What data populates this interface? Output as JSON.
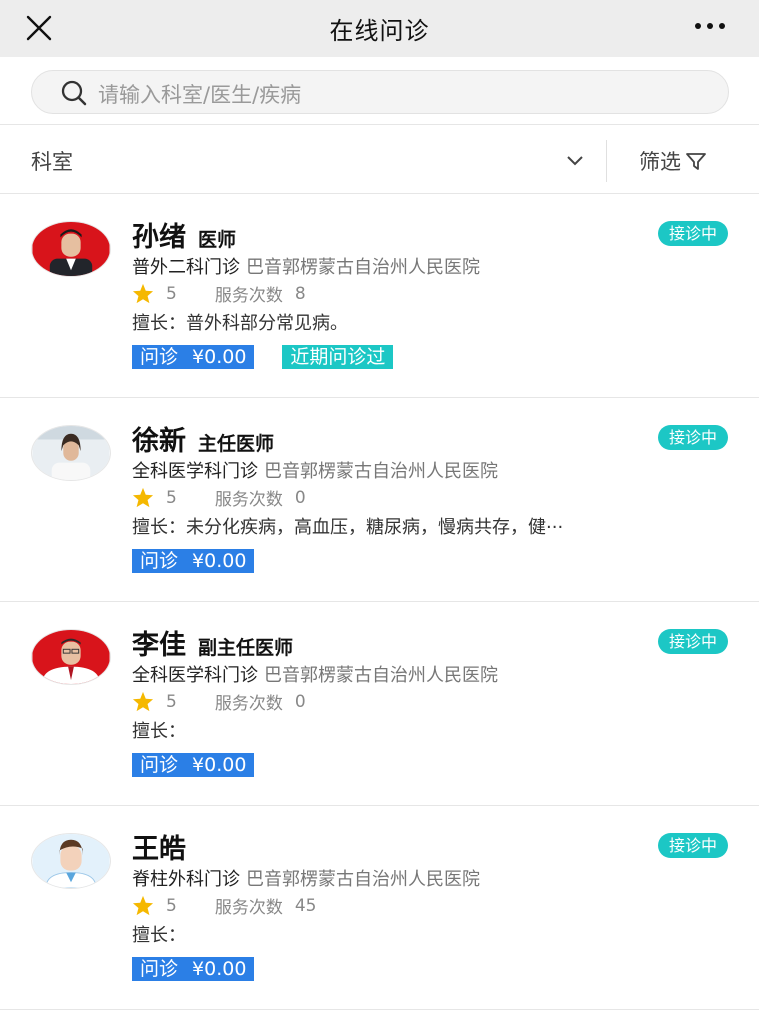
{
  "header": {
    "title": "在线问诊"
  },
  "search": {
    "placeholder": "请输入科室/医生/疾病"
  },
  "filter_bar": {
    "department_label": "科室",
    "filter_label": "筛选"
  },
  "doctors": [
    {
      "name": "孙绪",
      "title": "医师",
      "status": "接诊中",
      "department": "普外二科门诊",
      "hospital": "巴音郭楞蒙古自治州人民医院",
      "rating": "5",
      "service_label": "服务次数",
      "service_count": "8",
      "expertise": "擅长：普外科部分常见病。",
      "consult_label": "问诊",
      "price": "¥0.00",
      "recent_tag": "近期问诊过"
    },
    {
      "name": "徐新",
      "title": "主任医师",
      "status": "接诊中",
      "department": "全科医学科门诊",
      "hospital": "巴音郭楞蒙古自治州人民医院",
      "rating": "5",
      "service_label": "服务次数",
      "service_count": "0",
      "expertise": "擅长：未分化疾病，高血压，糖尿病，慢病共存，健···",
      "consult_label": "问诊",
      "price": "¥0.00"
    },
    {
      "name": "李佳",
      "title": "副主任医师",
      "status": "接诊中",
      "department": "全科医学科门诊",
      "hospital": "巴音郭楞蒙古自治州人民医院",
      "rating": "5",
      "service_label": "服务次数",
      "service_count": "0",
      "expertise": "擅长：",
      "consult_label": "问诊",
      "price": "¥0.00"
    },
    {
      "name": "王皓",
      "title": "",
      "status": "接诊中",
      "department": "脊柱外科门诊",
      "hospital": "巴音郭楞蒙古自治州人民医院",
      "rating": "5",
      "service_label": "服务次数",
      "service_count": "45",
      "expertise": "擅长：",
      "consult_label": "问诊",
      "price": "¥0.00"
    }
  ],
  "colors": {
    "status_bg": "#1cc7c5",
    "price_tag_bg": "#2b7fe6",
    "star": "#f5b800",
    "topbar_bg": "#ededed"
  },
  "icons": {
    "close": "close-icon",
    "more": "more-dots-icon",
    "search": "search-icon",
    "dropdown": "chevron-down-icon",
    "filter": "filter-funnel-icon",
    "rating": "star-icon"
  }
}
